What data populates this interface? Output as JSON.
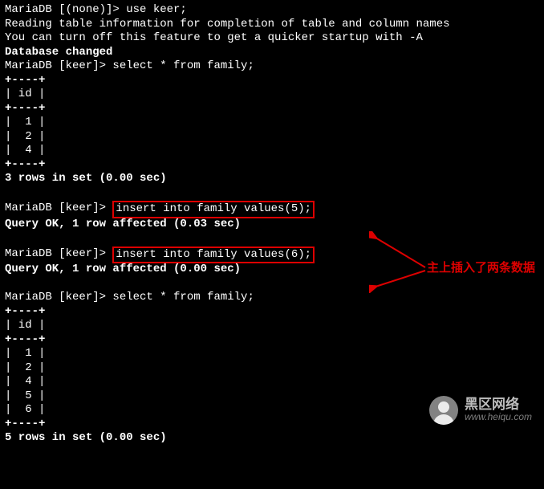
{
  "terminal": {
    "l01": "MariaDB [(none)]> use keer;",
    "l02": "Reading table information for completion of table and column names",
    "l03": "You can turn off this feature to get a quicker startup with -A",
    "l04": "",
    "l05": "Database changed",
    "l06": "MariaDB [keer]> select * from family;",
    "l07": "+----+",
    "l08": "| id |",
    "l09": "+----+",
    "l10": "|  1 |",
    "l11": "|  2 |",
    "l12": "|  4 |",
    "l13": "+----+",
    "l14": "3 rows in set (0.00 sec)",
    "l15": "",
    "l16_prompt": "MariaDB [keer]> ",
    "l16_cmd": "insert into family values(5);",
    "l17": "Query OK, 1 row affected (0.03 sec)",
    "l18": "",
    "l19_prompt": "MariaDB [keer]> ",
    "l19_cmd": "insert into family values(6);",
    "l20": "Query OK, 1 row affected (0.00 sec)",
    "l21": "",
    "l22": "MariaDB [keer]> select * from family;",
    "l23": "+----+",
    "l24": "| id |",
    "l25": "+----+",
    "l26": "|  1 |",
    "l27": "|  2 |",
    "l28": "|  4 |",
    "l29": "|  5 |",
    "l30": "|  6 |",
    "l31": "+----+",
    "l32": "5 rows in set (0.00 sec)"
  },
  "annotation": {
    "text": "主上插入了两条数据"
  },
  "watermark": {
    "cn": "黑区网络",
    "en": "www.heiqu.com"
  }
}
